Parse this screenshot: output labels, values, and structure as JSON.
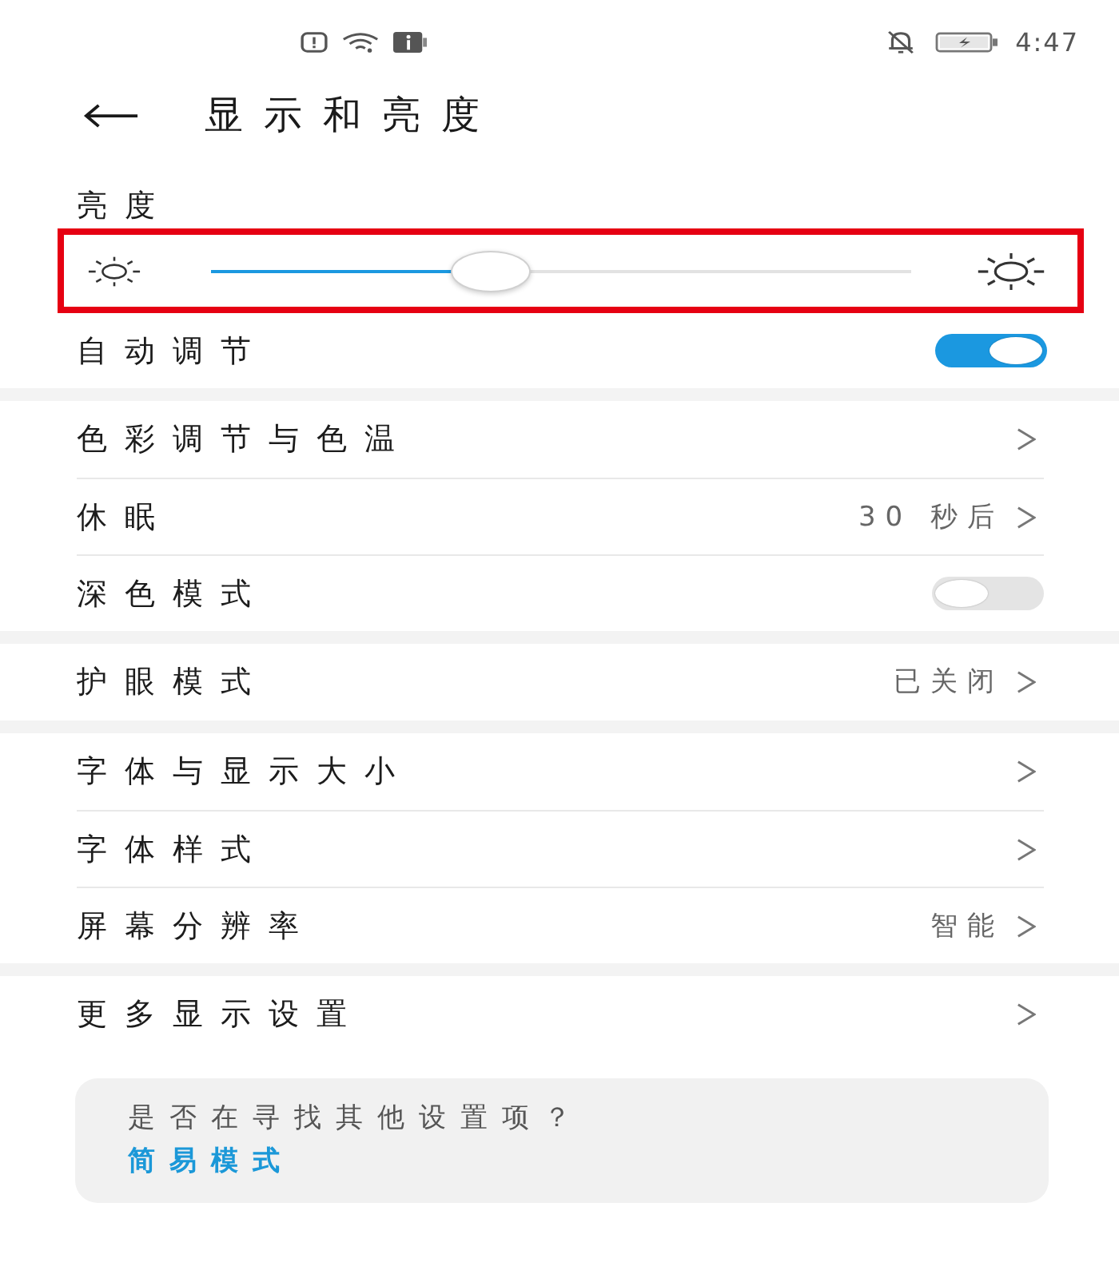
{
  "status_bar": {
    "time": "4:47"
  },
  "header": {
    "title": "显示和亮度"
  },
  "brightness": {
    "label": "亮度",
    "level": 0.4,
    "highlighted": true
  },
  "auto_adjust": {
    "label": "自动调节",
    "on": true
  },
  "groups": [
    {
      "items": [
        {
          "kind": "link",
          "label": "色彩调节与色温"
        },
        {
          "kind": "link",
          "label": "休眠",
          "value": "30 秒后"
        },
        {
          "kind": "toggle",
          "label": "深色模式",
          "on": false
        }
      ]
    },
    {
      "items": [
        {
          "kind": "link",
          "label": "护眼模式",
          "value": "已关闭"
        }
      ]
    },
    {
      "items": [
        {
          "kind": "link",
          "label": "字体与显示大小"
        },
        {
          "kind": "link",
          "label": "字体样式"
        },
        {
          "kind": "link",
          "label": "屏幕分辨率",
          "value": "智能"
        }
      ]
    },
    {
      "items": [
        {
          "kind": "link",
          "label": "更多显示设置"
        }
      ]
    }
  ],
  "suggestion": {
    "question": "是否在寻找其他设置项？",
    "link": "简易模式"
  }
}
